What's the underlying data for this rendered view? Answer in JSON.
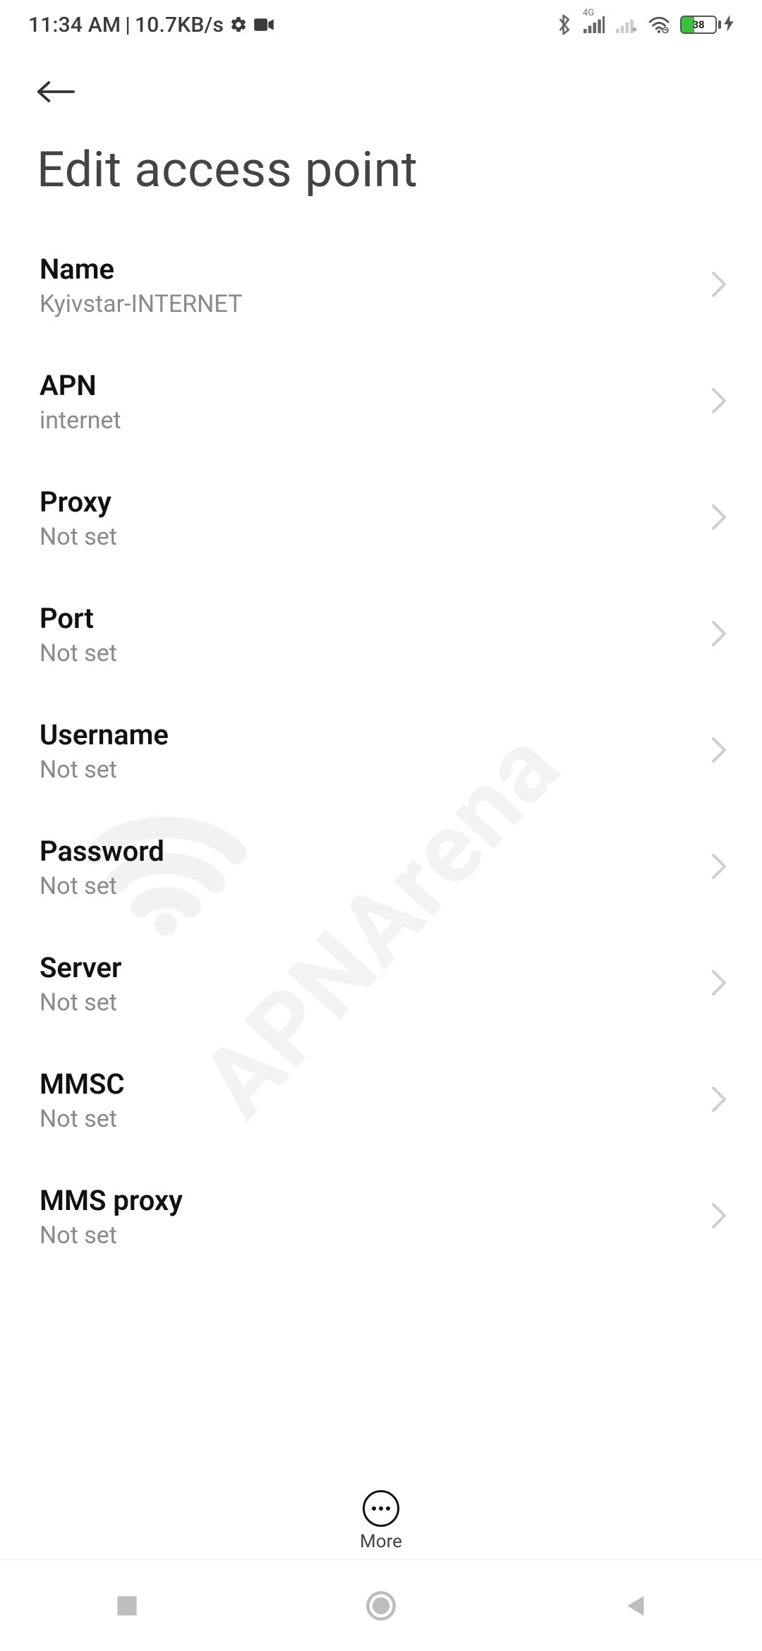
{
  "status": {
    "time": "11:34 AM",
    "net_speed": "10.7KB/s",
    "battery_percent": "38",
    "sim_label": "4G"
  },
  "header": {
    "title": "Edit access point"
  },
  "rows": [
    {
      "label": "Name",
      "value": "Kyivstar-INTERNET"
    },
    {
      "label": "APN",
      "value": "internet"
    },
    {
      "label": "Proxy",
      "value": "Not set"
    },
    {
      "label": "Port",
      "value": "Not set"
    },
    {
      "label": "Username",
      "value": "Not set"
    },
    {
      "label": "Password",
      "value": "Not set"
    },
    {
      "label": "Server",
      "value": "Not set"
    },
    {
      "label": "MMSC",
      "value": "Not set"
    },
    {
      "label": "MMS proxy",
      "value": "Not set"
    }
  ],
  "more_label": "More",
  "watermark": "APNArena"
}
